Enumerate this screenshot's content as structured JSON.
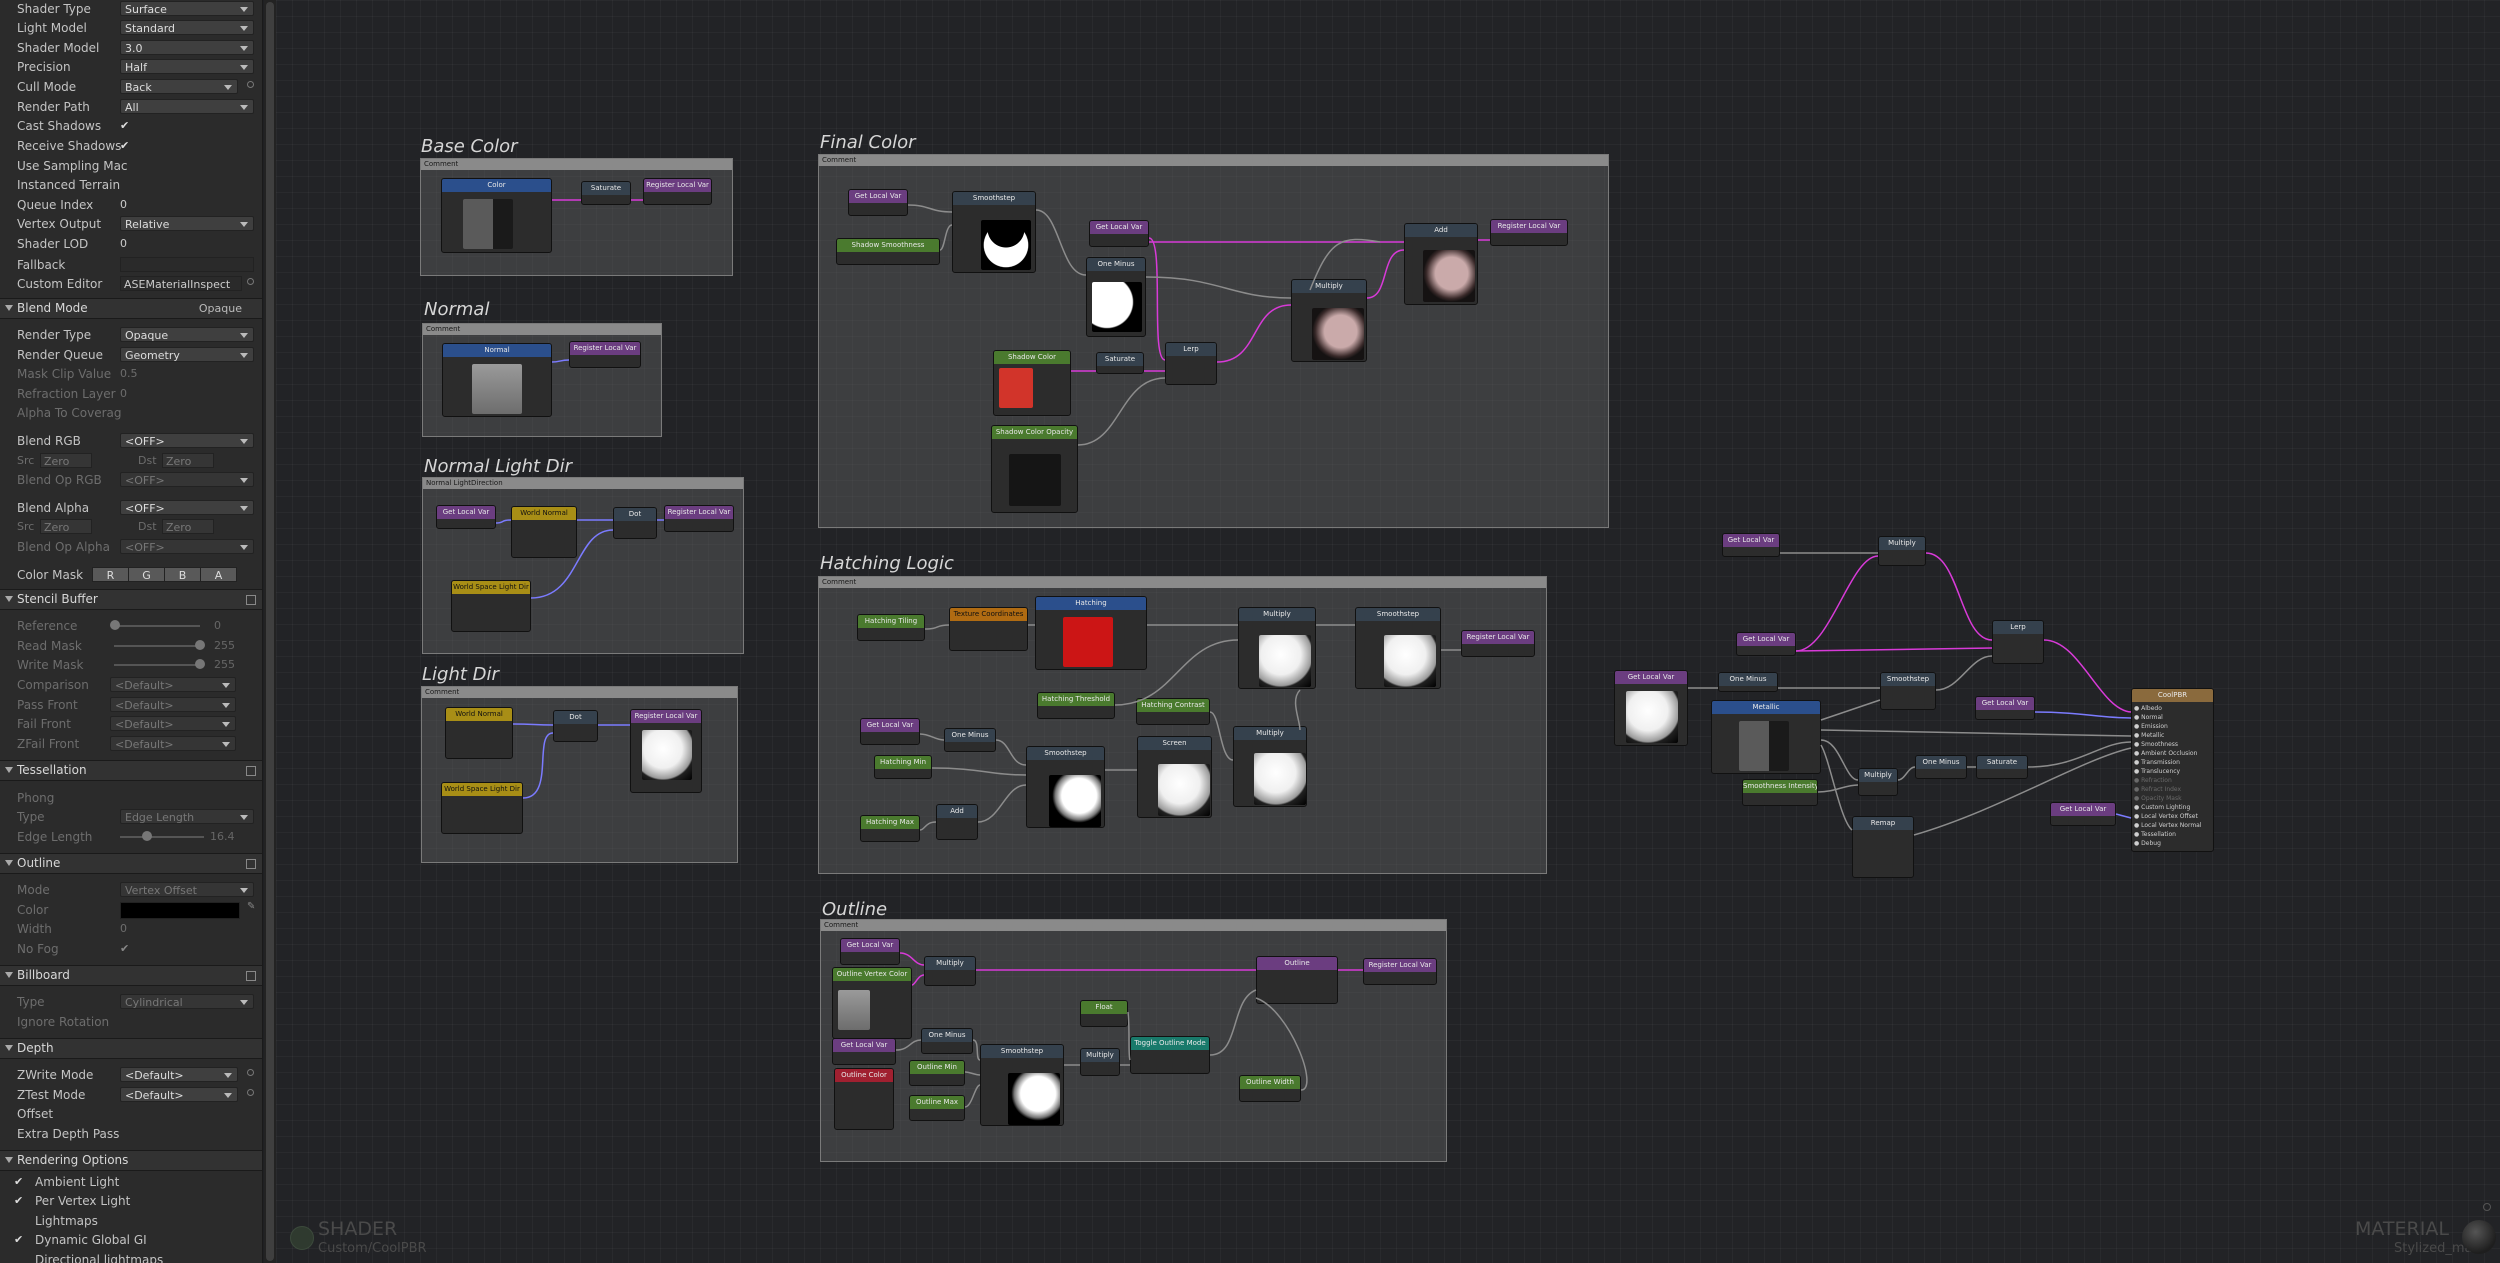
{
  "inspector": {
    "shader_type": {
      "label": "Shader Type",
      "value": "Surface"
    },
    "light_model": {
      "label": "Light Model",
      "value": "Standard"
    },
    "shader_model": {
      "label": "Shader Model",
      "value": "3.0"
    },
    "precision": {
      "label": "Precision",
      "value": "Half"
    },
    "cull_mode": {
      "label": "Cull Mode",
      "value": "Back"
    },
    "render_path": {
      "label": "Render Path",
      "value": "All"
    },
    "cast_shadows": {
      "label": "Cast Shadows",
      "value": "✔"
    },
    "receive_shadows": {
      "label": "Receive Shadows",
      "value": "✔"
    },
    "use_sampling": {
      "label": "Use Sampling Mac"
    },
    "instanced_terrain": {
      "label": "Instanced Terrain"
    },
    "queue_index": {
      "label": "Queue Index",
      "value": "0"
    },
    "vertex_output": {
      "label": "Vertex Output",
      "value": "Relative"
    },
    "shader_lod": {
      "label": "Shader LOD",
      "value": "0"
    },
    "fallback": {
      "label": "Fallback",
      "value": ""
    },
    "custom_editor": {
      "label": "Custom Editor",
      "value": "ASEMaterialInspect"
    },
    "blend_mode": {
      "label": "Blend Mode",
      "value": "Opaque"
    },
    "render_type": {
      "label": "Render Type",
      "value": "Opaque"
    },
    "render_queue": {
      "label": "Render Queue",
      "value": "Geometry"
    },
    "mask_clip": {
      "label": "Mask Clip Value",
      "value": "0.5"
    },
    "refraction_layer": {
      "label": "Refraction Layer",
      "value": "0"
    },
    "alpha_to_coverage": {
      "label": "Alpha To Coverag"
    },
    "blend_rgb": {
      "label": "Blend RGB",
      "value": "<OFF>"
    },
    "blend_rgb_src": {
      "src": "Src",
      "src_val": "Zero",
      "dst": "Dst",
      "dst_val": "Zero"
    },
    "blend_op_rgb": {
      "label": "Blend Op RGB",
      "value": "<OFF>"
    },
    "blend_alpha": {
      "label": "Blend Alpha",
      "value": "<OFF>"
    },
    "blend_alpha_src": {
      "src": "Src",
      "src_val": "Zero",
      "dst": "Dst",
      "dst_val": "Zero"
    },
    "blend_op_alpha": {
      "label": "Blend Op Alpha",
      "value": "<OFF>"
    },
    "color_mask": {
      "label": "Color Mask",
      "r": "R",
      "g": "G",
      "b": "B",
      "a": "A"
    },
    "stencil_buffer": {
      "label": "Stencil Buffer"
    },
    "reference": {
      "label": "Reference",
      "value": "0"
    },
    "read_mask": {
      "label": "Read Mask",
      "value": "255"
    },
    "write_mask": {
      "label": "Write Mask",
      "value": "255"
    },
    "comparison": {
      "label": "Comparison",
      "value": "<Default>"
    },
    "pass_front": {
      "label": "Pass Front",
      "value": "<Default>"
    },
    "fail_front": {
      "label": "Fail Front",
      "value": "<Default>"
    },
    "zfail_front": {
      "label": "ZFail Front",
      "value": "<Default>"
    },
    "tessellation": {
      "label": "Tessellation"
    },
    "phong": {
      "label": "Phong"
    },
    "tess_type": {
      "label": "Type",
      "value": "Edge Length"
    },
    "edge_length": {
      "label": "Edge Length",
      "value": "16.4"
    },
    "outline": {
      "label": "Outline"
    },
    "outline_mode": {
      "label": "Mode",
      "value": "Vertex Offset"
    },
    "outline_color": {
      "label": "Color"
    },
    "outline_width": {
      "label": "Width",
      "value": "0"
    },
    "no_fog": {
      "label": "No Fog",
      "value": "✔"
    },
    "billboard": {
      "label": "Billboard"
    },
    "billboard_type": {
      "label": "Type",
      "value": "Cylindrical"
    },
    "ignore_rotation": {
      "label": "Ignore Rotation"
    },
    "depth": {
      "label": "Depth"
    },
    "zwrite": {
      "label": "ZWrite Mode",
      "value": "<Default>"
    },
    "ztest": {
      "label": "ZTest Mode",
      "value": "<Default>"
    },
    "offset": {
      "label": "Offset"
    },
    "extra_depth": {
      "label": "Extra Depth Pass"
    },
    "rendering_options": {
      "label": "Rendering Options"
    },
    "ambient_light": {
      "label": "Ambient Light",
      "value": "✔"
    },
    "per_vertex_light": {
      "label": "Per Vertex Light",
      "value": "✔"
    },
    "lightmaps": {
      "label": "Lightmaps"
    },
    "dynamic_gi": {
      "label": "Dynamic Global GI",
      "value": "✔"
    },
    "directional_lightmaps": {
      "label": "Directional lightmaps"
    }
  },
  "groups": {
    "base_color": {
      "title": "Base Color",
      "tag": "Comment"
    },
    "normal": {
      "title": "Normal",
      "tag": "Comment"
    },
    "normal_light_dir": {
      "title": "Normal Light Dir",
      "tag": "Normal LightDirection"
    },
    "light_dir": {
      "title": "Light Dir",
      "tag": "Comment"
    },
    "final_color": {
      "title": "Final Color",
      "tag": "Comment"
    },
    "hatching_logic": {
      "title": "Hatching Logic",
      "tag": "Comment"
    },
    "outline": {
      "title": "Outline",
      "tag": "Comment"
    }
  },
  "nodes": {
    "color": "Color",
    "saturate": "Saturate",
    "register_local_var": "Register Local Var",
    "get_local_var": "Get Local Var",
    "normal": "Normal",
    "world_normal": "World Normal",
    "dot": "Dot",
    "world_space_light_dir": "World Space Light Dir",
    "smoothstep": "Smoothstep",
    "shadow_smoothness": "Shadow Smoothness",
    "one_minus": "One Minus",
    "shadow_color": "Shadow Color",
    "shadow_color_opacity": "Shadow Color Opacity",
    "lerp": "Lerp",
    "multiply": "Multiply",
    "add": "Add",
    "hatching_tiling": "Hatching Tiling",
    "texture_coordinates": "Texture Coordinates",
    "hatching": "Hatching",
    "hatching_threshold": "Hatching Threshold",
    "hatching_contrast": "Hatching Contrast",
    "hatching_min": "Hatching Min",
    "hatching_max": "Hatching Max",
    "screen": "Screen",
    "outline_vertex_color": "Outline Vertex Color",
    "outline_color": "Outline Color",
    "outline_min": "Outline Min",
    "outline_max": "Outline Max",
    "outline_width": "Outline Width",
    "outline": "Outline",
    "toggle_outline_mode": "Toggle Outline Mode",
    "float": "Float",
    "metallic": "Metallic",
    "smoothness_intensity": "Smoothness Intensity",
    "remap": "Remap",
    "custom_pbr": "CoolPBR"
  },
  "output_ports": [
    "Albedo",
    "Normal",
    "Emission",
    "Metallic",
    "Smoothness",
    "Ambient Occlusion",
    "Transmission",
    "Translucency",
    "Refraction",
    "Refract Index",
    "Opacity Mask",
    "Custom Lighting",
    "Local Vertex Offset",
    "Local Vertex Normal",
    "Tessellation",
    "Debug"
  ],
  "footer": {
    "shader_label": "SHADER",
    "shader_name": "Custom/CoolPBR",
    "material_label": "MATERIAL",
    "material_name": "Stylized_mat"
  },
  "colors": {
    "wire_pink": "#d83ad8",
    "wire_gray": "#8c8c8c",
    "wire_blue": "#7b7bff",
    "canvas": "#222326"
  }
}
